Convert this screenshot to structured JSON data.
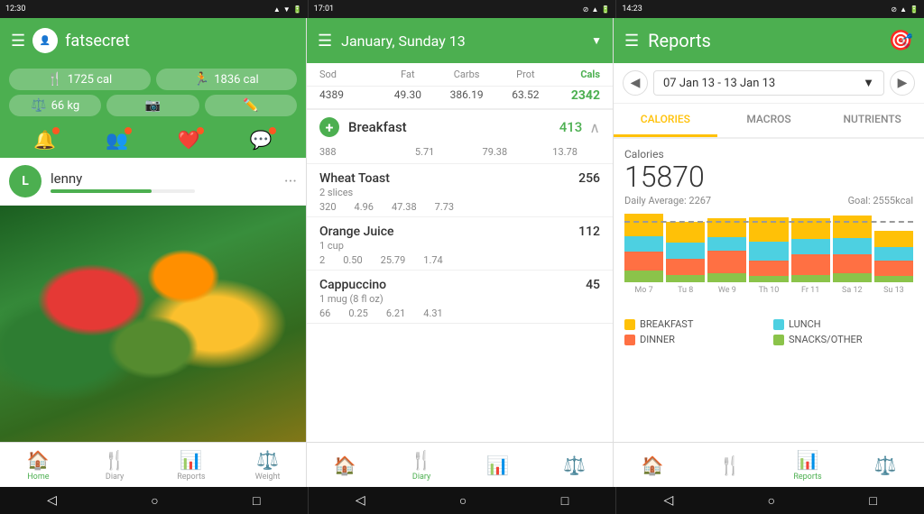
{
  "statusBars": [
    {
      "time": "12:30",
      "icons": [
        "▲",
        "▼",
        "■",
        "⊡",
        "▲"
      ]
    },
    {
      "time": "17:01",
      "icons": [
        "⊘",
        "▲",
        "▼",
        "⊡",
        "▲"
      ]
    },
    {
      "time": "14:23",
      "icons": [
        "⊘",
        "▲",
        "▼",
        "⊡",
        "▲"
      ]
    }
  ],
  "panel1": {
    "appName": "fatsecret",
    "caloriesIn": "1725 cal",
    "caloriesOut": "1836 cal",
    "weight": "66 kg",
    "username": "lenny",
    "navItems": [
      {
        "label": "Home",
        "active": true
      },
      {
        "label": "Diary",
        "active": false
      },
      {
        "label": "Reports",
        "active": false
      },
      {
        "label": "Weight",
        "active": false
      }
    ]
  },
  "panel2": {
    "dateTitle": "January, Sunday 13",
    "columns": {
      "sod": "Sod",
      "fat": "Fat",
      "carbs": "Carbs",
      "prot": "Prot",
      "cals": "Cals"
    },
    "totals": {
      "sod": "4389",
      "fat": "49.30",
      "carbs": "386.19",
      "prot": "63.52",
      "cals": "2342"
    },
    "meals": [
      {
        "name": "Breakfast",
        "calories": 413,
        "sod": "388",
        "fat": "5.71",
        "carbs": "79.38",
        "prot": "13.78",
        "items": [
          {
            "name": "Wheat Toast",
            "desc": "2 slices",
            "calories": 256,
            "sod": "320",
            "fat": "4.96",
            "carbs": "47.38",
            "prot": "7.73"
          },
          {
            "name": "Orange Juice",
            "desc": "1 cup",
            "calories": 112,
            "sod": "2",
            "fat": "0.50",
            "carbs": "25.79",
            "prot": "1.74"
          },
          {
            "name": "Cappuccino",
            "desc": "1 mug (8 fl oz)",
            "calories": 45,
            "sod": "66",
            "fat": "0.25",
            "carbs": "6.21",
            "prot": "4.31"
          }
        ]
      }
    ],
    "navItems": [
      {
        "label": "",
        "active": false
      },
      {
        "label": "Diary",
        "active": true
      },
      {
        "label": "",
        "active": false
      },
      {
        "label": "",
        "active": false
      }
    ]
  },
  "panel3": {
    "title": "Reports",
    "dateRange": "07 Jan 13 - 13 Jan 13",
    "tabs": [
      {
        "label": "CALORIES",
        "active": true
      },
      {
        "label": "MACROS",
        "active": false
      },
      {
        "label": "NUTRIENTS",
        "active": false
      }
    ],
    "caloriesLabel": "Calories",
    "caloriesTotal": "15870",
    "dailyAverage": "Daily Average: 2267",
    "goal": "Goal: 2555kcal",
    "chartDays": [
      {
        "label": "Mo 7",
        "breakfast": 30,
        "lunch": 20,
        "dinner": 25,
        "snacks": 15
      },
      {
        "label": "Tu 8",
        "breakfast": 28,
        "lunch": 22,
        "dinner": 22,
        "snacks": 10
      },
      {
        "label": "We 9",
        "breakfast": 25,
        "lunch": 18,
        "dinner": 30,
        "snacks": 12
      },
      {
        "label": "Th 10",
        "breakfast": 32,
        "lunch": 25,
        "dinner": 20,
        "snacks": 8
      },
      {
        "label": "Fr 11",
        "breakfast": 27,
        "lunch": 20,
        "dinner": 28,
        "snacks": 10
      },
      {
        "label": "Sa 12",
        "breakfast": 30,
        "lunch": 22,
        "dinner": 25,
        "snacks": 12
      },
      {
        "label": "Su 13",
        "breakfast": 22,
        "lunch": 18,
        "dinner": 20,
        "snacks": 8
      }
    ],
    "legend": [
      {
        "label": "BREAKFAST",
        "color": "#ffc107"
      },
      {
        "label": "LUNCH",
        "color": "#4dd0e1"
      },
      {
        "label": "DINNER",
        "color": "#ff7043"
      },
      {
        "label": "SNACKS/OTHER",
        "color": "#8bc34a"
      }
    ],
    "navItems": [
      {
        "label": "",
        "active": false
      },
      {
        "label": "",
        "active": false
      },
      {
        "label": "Reports",
        "active": true
      },
      {
        "label": "",
        "active": false
      }
    ]
  }
}
